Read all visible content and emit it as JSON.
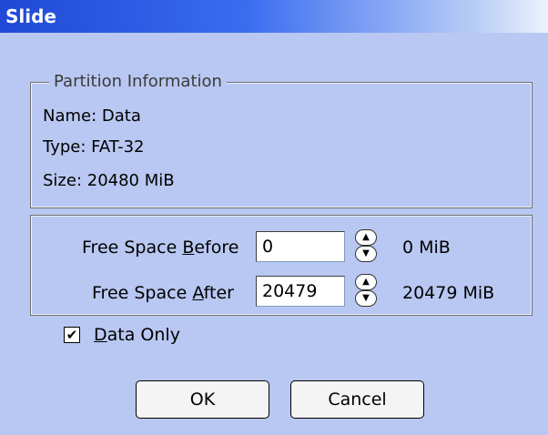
{
  "window": {
    "title": "Slide"
  },
  "partition_info": {
    "legend": "Partition Information",
    "name": "Name: Data",
    "type": "Type: FAT-32",
    "size": "Size: 20480 MiB"
  },
  "free_space": {
    "before": {
      "label_pre": "Free Space ",
      "label_accel": "B",
      "label_post": "efore",
      "value": "0",
      "mib": "0 MiB"
    },
    "after": {
      "label_pre": "Free Space ",
      "label_accel": "A",
      "label_post": "fter",
      "value": "20479",
      "mib": "20479 MiB"
    }
  },
  "data_only": {
    "checked": true,
    "label_accel": "D",
    "label_post": "ata Only"
  },
  "buttons": {
    "ok": "OK",
    "cancel": "Cancel"
  }
}
